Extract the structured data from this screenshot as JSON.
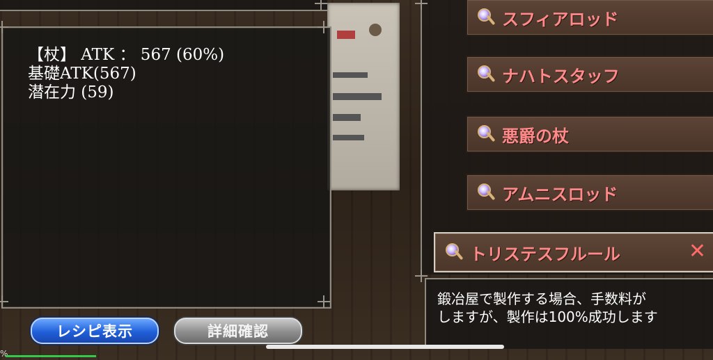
{
  "info": {
    "line1": "【杖】 ATK ： 567 (60%)",
    "line2": "基礎ATK(567)",
    "line3": "潜在力 (59)"
  },
  "buttons": {
    "recipe": "レシピ表示",
    "detail": "詳細確認"
  },
  "list": {
    "items": [
      "スフィアロッド",
      "ナハトスタッフ",
      "悪爵の杖",
      "アムニスロッド"
    ],
    "selected": "トリステスフルール",
    "close_glyph": "✕"
  },
  "description": {
    "line1": "鍛冶屋で製作する場合、手数料が",
    "line2": "しますが、製作は100%成功します"
  },
  "status": {
    "percent": "%"
  }
}
